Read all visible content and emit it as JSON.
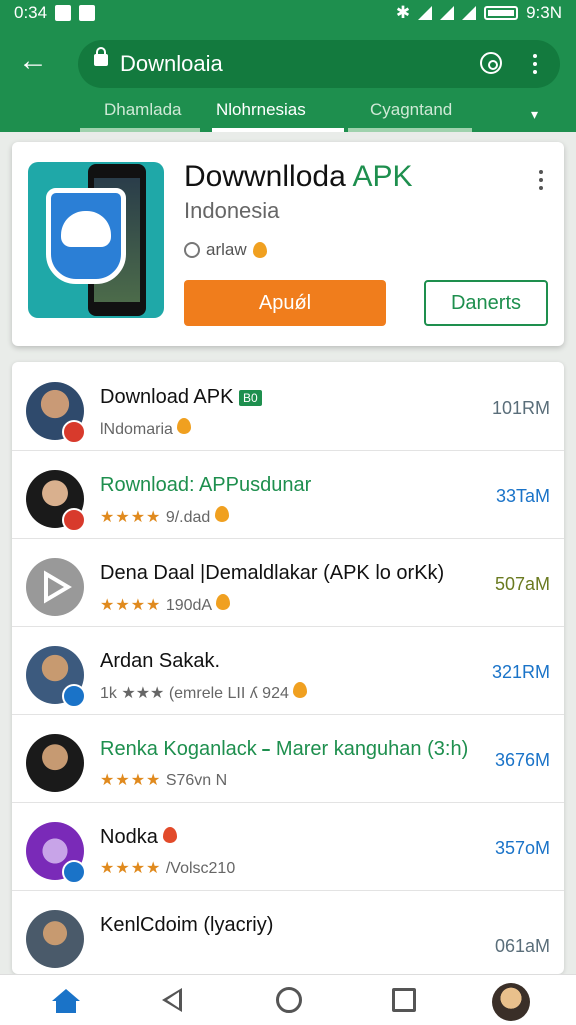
{
  "status": {
    "time": "0:34",
    "clock_right": "9:3N"
  },
  "browser": {
    "url": "Downloaia"
  },
  "tabs": [
    {
      "label": "Dhamlada",
      "active": false
    },
    {
      "label": "Nlohrnesias",
      "active": true
    },
    {
      "label": "Cyagntand",
      "active": false
    }
  ],
  "featured": {
    "title_main": "Dowwnlloda ",
    "title_accent": "APK",
    "developer": "Indonesia",
    "meta": "arlaw",
    "install_label": "Apuǿl",
    "open_label": "Danerts"
  },
  "list": [
    {
      "title": "Download APK",
      "tag": "B0",
      "subtitle": "lNdomaria",
      "stars": "",
      "size": "101RM",
      "title_color": "#111111",
      "size_color": "#5a6e7a"
    },
    {
      "title": "Rownload: APPusdunar",
      "subtitle": "9/.dad",
      "stars": "★★★★",
      "size": "33TaM",
      "title_color": "#1e8f4e",
      "size_color": "#1a73c8"
    },
    {
      "title": "Dena Daal |Demaldlakar (APK lo orKk)",
      "subtitle": "190dA",
      "stars": "★★★★",
      "size": "507aM",
      "title_color": "#111111",
      "size_color": "#6a7a20"
    },
    {
      "title": "Ardan Sakak.",
      "subtitle": "1k ★★★   (emrele LII ʎ 924",
      "stars": "",
      "size": "321RM",
      "title_color": "#111111",
      "size_color": "#1a73c8"
    },
    {
      "title": "Renka Koganlack",
      "tag": "",
      "title_extra": "Marer kanguhan (3:h)",
      "subtitle": "S76vn N",
      "stars": "★★★★",
      "size": "3676M",
      "title_color": "#1e8f4e",
      "size_color": "#1a73c8"
    },
    {
      "title": "Nodka",
      "subtitle": "/Volsc210",
      "stars": "★★★★",
      "size": "357oM",
      "title_color": "#111111",
      "size_color": "#1a73c8"
    },
    {
      "title": "KenlCdoim (lyacriy)",
      "subtitle": "",
      "stars": "",
      "size": "061aM",
      "title_color": "#111111",
      "size_color": "#5a6e7a"
    }
  ],
  "icons": [
    "back-arrow-icon",
    "lock-icon",
    "tab-icon",
    "menu-icon",
    "home-icon",
    "back-triangle-icon",
    "home-circle-icon",
    "recent-square-icon"
  ]
}
